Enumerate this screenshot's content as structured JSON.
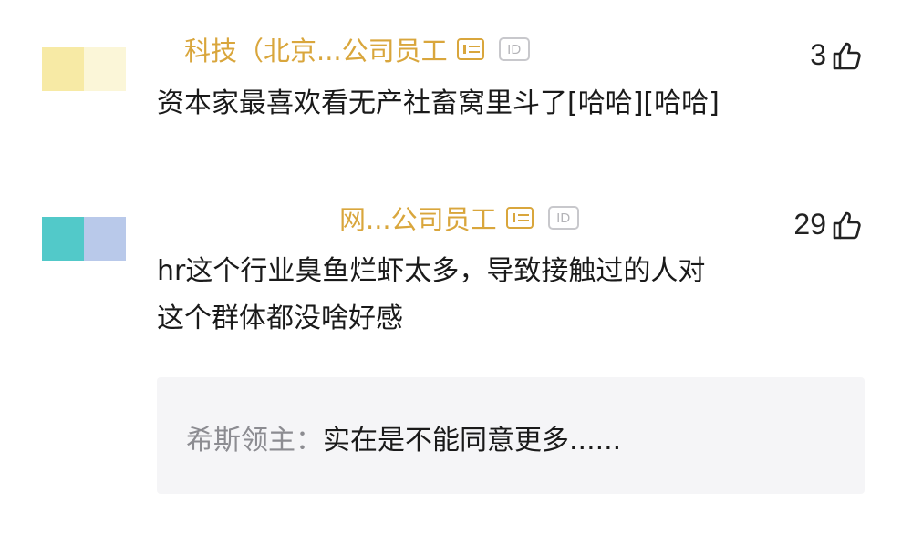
{
  "comments": [
    {
      "author_visible": "科技（北京...公司员工",
      "likes": "3",
      "text": "资本家最喜欢看无产社畜窝里斗了[哈哈][哈哈]"
    },
    {
      "author_visible": "网...公司员工",
      "likes": "29",
      "text_line1": "hr这个行业臭鱼烂虾太多，导致接触过的人对",
      "text_line2": "这个群体都没啥好感",
      "reply": {
        "name": "希斯领主：",
        "text": "实在是不能同意更多......"
      }
    }
  ],
  "id_badge_label": "ID",
  "colors": {
    "author": "#d9a63c",
    "reply_bg": "#f5f5f7",
    "reply_name": "#8c8c91",
    "avatar1": "#f7eaa5",
    "avatar2a": "#52c9c9",
    "avatar2b": "#b9c9ea"
  },
  "icons": [
    "thumbs-up-icon",
    "employee-badge-icon",
    "id-badge-icon"
  ]
}
